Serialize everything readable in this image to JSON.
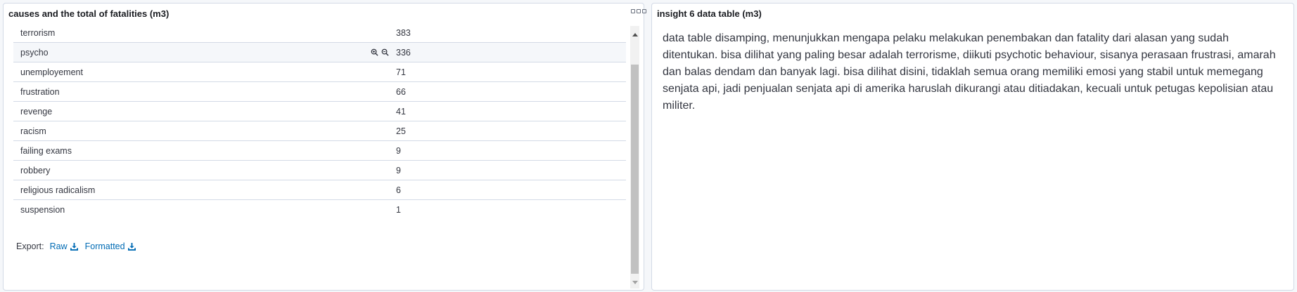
{
  "left_panel": {
    "title": "causes and the total of fatalities (m3)",
    "rows": [
      {
        "name": "terrorism",
        "value": "383"
      },
      {
        "name": "psycho",
        "value": "336"
      },
      {
        "name": "unemployement",
        "value": "71"
      },
      {
        "name": "frustration",
        "value": "66"
      },
      {
        "name": "revenge",
        "value": "41"
      },
      {
        "name": "racism",
        "value": "25"
      },
      {
        "name": "failing exams",
        "value": "9"
      },
      {
        "name": "robbery",
        "value": "9"
      },
      {
        "name": "religious radicalism",
        "value": "6"
      },
      {
        "name": "suspension",
        "value": "1"
      }
    ],
    "export": {
      "label": "Export:",
      "raw_label": "Raw",
      "formatted_label": "Formatted"
    },
    "icons": [
      "panel-options-icon",
      "filter-for-value-icon",
      "filter-out-value-icon",
      "download-icon"
    ]
  },
  "right_panel": {
    "title": "insight 6 data table (m3)",
    "text": "data table disamping, menunjukkan mengapa pelaku melakukan penembakan dan fatality dari alasan yang sudah ditentukan. bisa dilihat yang paling besar adalah terrorisme, diikuti psychotic behaviour, sisanya perasaan frustrasi, amarah dan balas dendam dan banyak lagi. bisa dilihat disini, tidaklah semua orang memiliki emosi yang stabil untuk memegang senjata api, jadi penjualan senjata api di amerika haruslah dikurangi atau ditiadakan, kecuali untuk petugas kepolisian atau militer."
  },
  "colors": {
    "link": "#006bb4",
    "border": "#d3dae6",
    "text": "#343741",
    "background": "#f5f7fa"
  }
}
